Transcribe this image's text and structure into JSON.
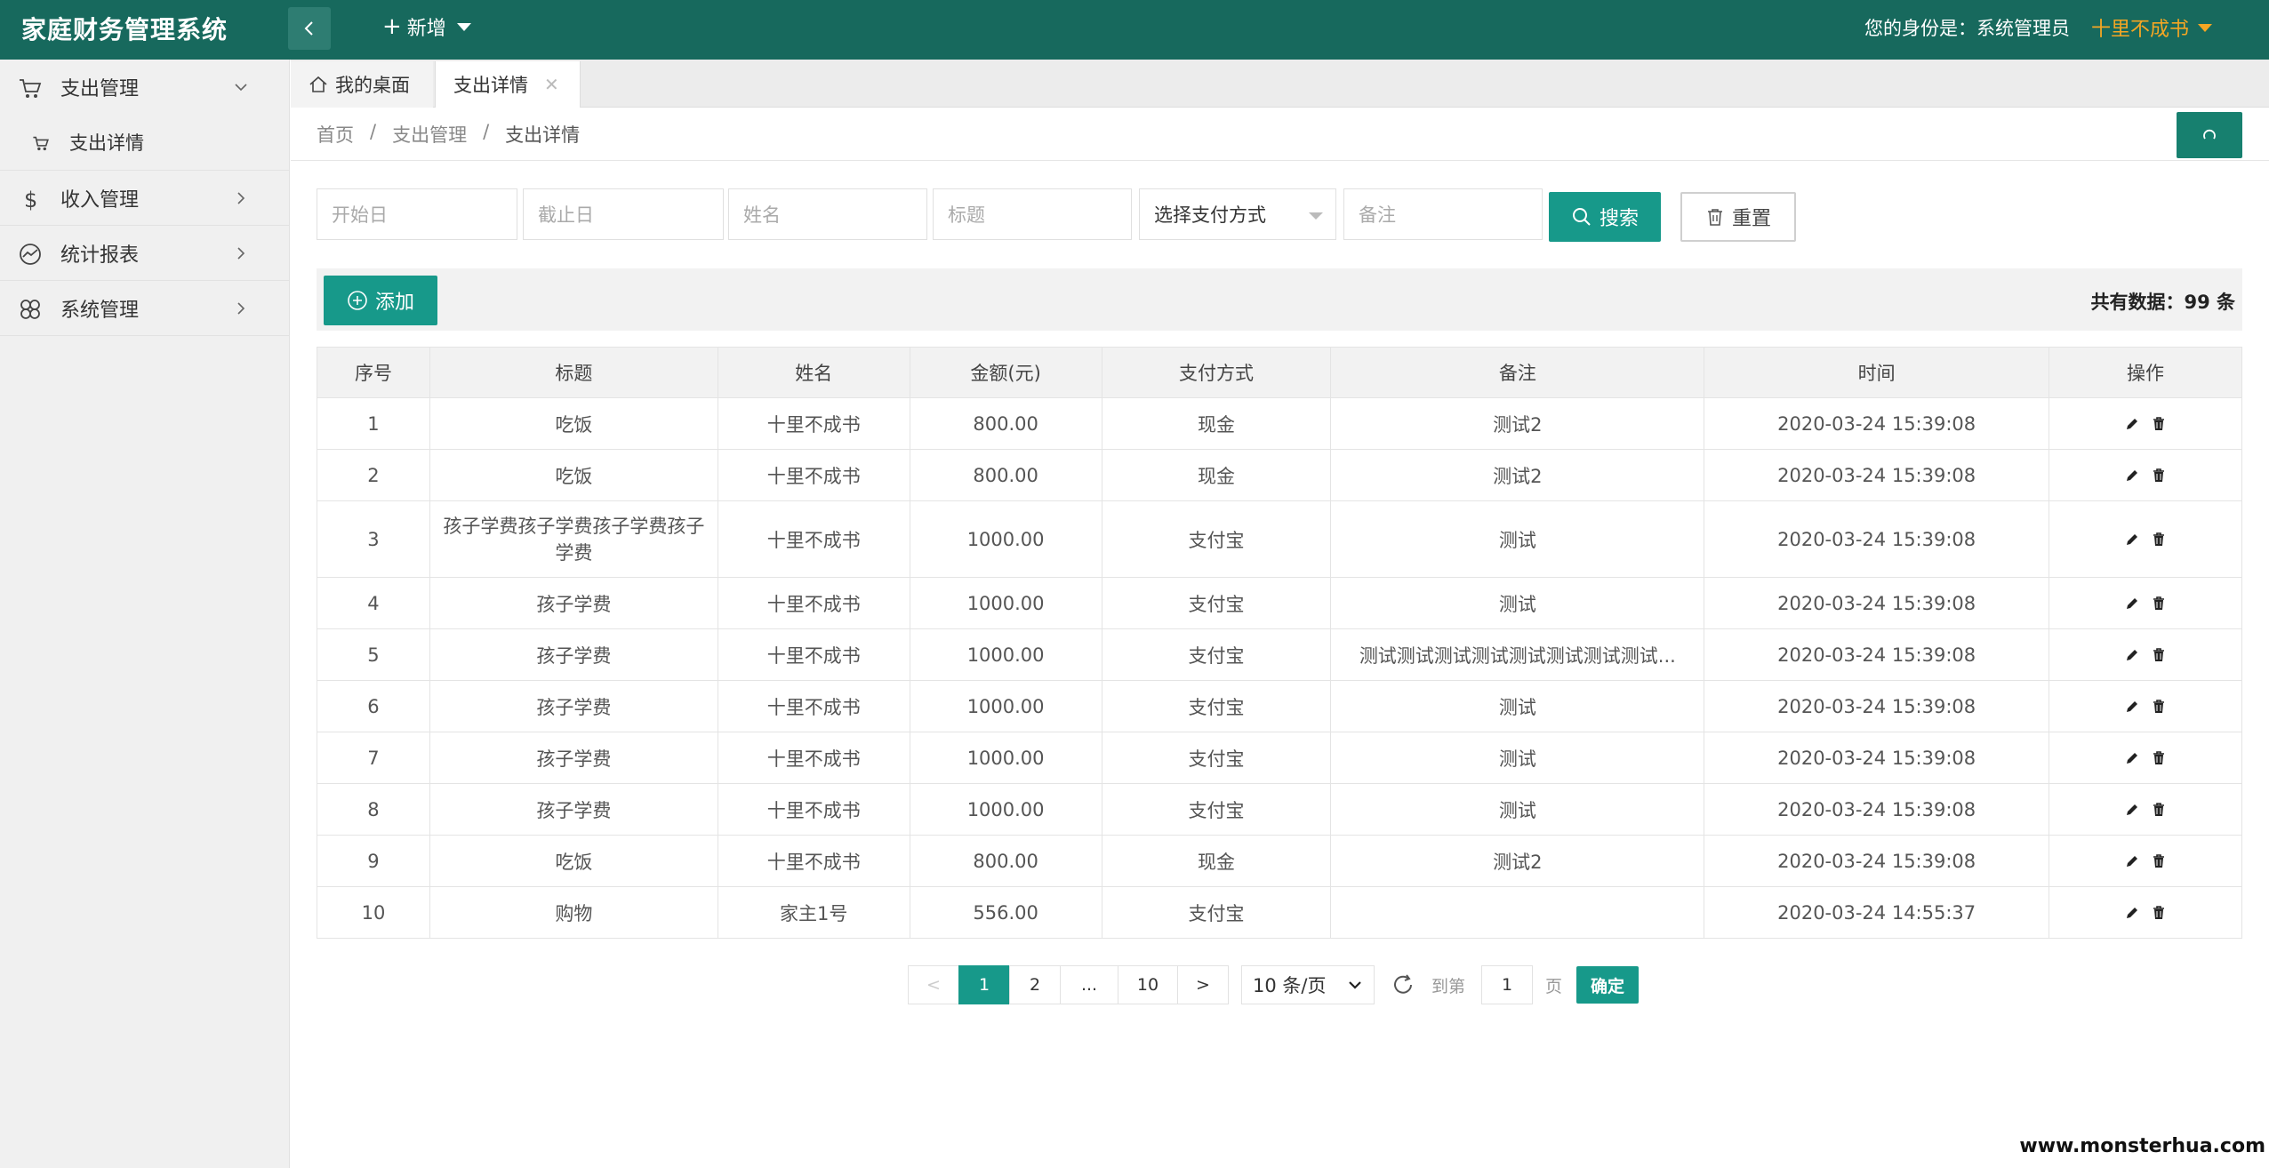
{
  "header": {
    "title": "家庭财务管理系统",
    "new_label": "新增",
    "identity_label": "您的身份是：系统管理员",
    "user_name": "十里不成书"
  },
  "sidebar": {
    "items": [
      {
        "label": "支出管理",
        "icon": "cart-icon",
        "expanded": true,
        "children": [
          {
            "label": "支出详情",
            "icon": "cart-icon"
          }
        ]
      },
      {
        "label": "收入管理",
        "icon": "dollar-icon"
      },
      {
        "label": "统计报表",
        "icon": "chart-line-icon"
      },
      {
        "label": "系统管理",
        "icon": "settings-icon"
      }
    ]
  },
  "tabs": {
    "home": "我的桌面",
    "active": "支出详情"
  },
  "breadcrumb": {
    "items": [
      "首页",
      "支出管理",
      "支出详情"
    ],
    "separator": "/"
  },
  "search": {
    "start_placeholder": "开始日",
    "end_placeholder": "截止日",
    "name_placeholder": "姓名",
    "title_placeholder": "标题",
    "pay_method_selected": "选择支付方式",
    "remark_placeholder": "备注",
    "search_label": "搜索",
    "reset_label": "重置"
  },
  "toolbar": {
    "add_label": "添加",
    "total_label": "共有数据：99 条"
  },
  "table": {
    "columns": [
      "序号",
      "标题",
      "姓名",
      "金额(元)",
      "支付方式",
      "备注",
      "时间",
      "操作"
    ],
    "rows": [
      [
        "1",
        "吃饭",
        "十里不成书",
        "800.00",
        "现金",
        "测试2",
        "2020-03-24 15:39:08"
      ],
      [
        "2",
        "吃饭",
        "十里不成书",
        "800.00",
        "现金",
        "测试2",
        "2020-03-24 15:39:08"
      ],
      [
        "3",
        "孩子学费孩子学费孩子学费孩子学费",
        "十里不成书",
        "1000.00",
        "支付宝",
        "测试",
        "2020-03-24 15:39:08"
      ],
      [
        "4",
        "孩子学费",
        "十里不成书",
        "1000.00",
        "支付宝",
        "测试",
        "2020-03-24 15:39:08"
      ],
      [
        "5",
        "孩子学费",
        "十里不成书",
        "1000.00",
        "支付宝",
        "测试测试测试测试测试测试测试测试...",
        "2020-03-24 15:39:08"
      ],
      [
        "6",
        "孩子学费",
        "十里不成书",
        "1000.00",
        "支付宝",
        "测试",
        "2020-03-24 15:39:08"
      ],
      [
        "7",
        "孩子学费",
        "十里不成书",
        "1000.00",
        "支付宝",
        "测试",
        "2020-03-24 15:39:08"
      ],
      [
        "8",
        "孩子学费",
        "十里不成书",
        "1000.00",
        "支付宝",
        "测试",
        "2020-03-24 15:39:08"
      ],
      [
        "9",
        "吃饭",
        "十里不成书",
        "800.00",
        "现金",
        "测试2",
        "2020-03-24 15:39:08"
      ],
      [
        "10",
        "购物",
        "家主1号",
        "556.00",
        "支付宝",
        "",
        "2020-03-24 14:55:37"
      ]
    ]
  },
  "pagination": {
    "prev": "<",
    "pages": [
      "1",
      "2",
      "...",
      "10"
    ],
    "next": ">",
    "per_page": "10 条/页",
    "goto_label": "到第",
    "goto_value": "1",
    "page_label": "页",
    "confirm_label": "确定"
  },
  "watermark": "www.monsterhua.com",
  "colors": {
    "header_bg": "#17695d",
    "accent": "#17998a",
    "user_name": "#f5a623"
  }
}
